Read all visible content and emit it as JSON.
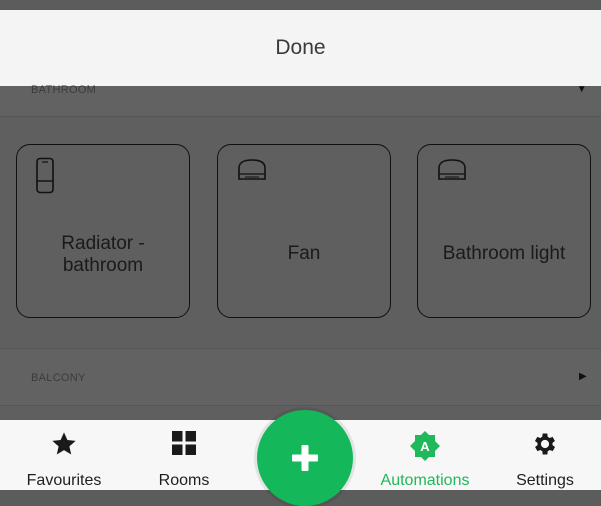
{
  "header": {
    "done_label": "Done"
  },
  "sections": [
    {
      "label": "BATHROOM"
    },
    {
      "label": "BALCONY"
    }
  ],
  "devices": [
    {
      "name": "Radiator -\nbathroom",
      "icon": "radiator-icon"
    },
    {
      "name": "Fan",
      "icon": "plug-icon"
    },
    {
      "name": "Bathroom light",
      "icon": "plug-icon"
    }
  ],
  "bottom_nav": [
    {
      "label": "Favourites",
      "icon": "star-icon"
    },
    {
      "label": "Rooms",
      "icon": "grid-icon"
    },
    {
      "label": "Automations",
      "icon": "automation-badge-icon",
      "badge": "A",
      "active": true
    },
    {
      "label": "Settings",
      "icon": "gear-icon"
    }
  ],
  "fab": {
    "icon": "plus-icon"
  },
  "colors": {
    "accent": "#1fb85a",
    "overlay": "#5f5f5f",
    "top_bar": "#f4f4f4"
  }
}
